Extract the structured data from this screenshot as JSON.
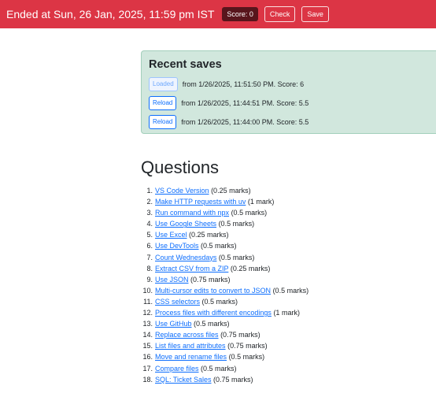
{
  "topbar": {
    "title": "Ended at Sun, 26 Jan, 2025, 11:59 pm IST",
    "score_label": "Score: 0",
    "check_label": "Check",
    "save_label": "Save"
  },
  "recent_saves": {
    "title": "Recent saves",
    "items": [
      {
        "button": "Loaded",
        "text": "from 1/26/2025, 11:51:50 PM. Score: 6"
      },
      {
        "button": "Reload",
        "text": "from 1/26/2025, 11:44:51 PM. Score: 5.5"
      },
      {
        "button": "Reload",
        "text": "from 1/26/2025, 11:44:00 PM. Score: 5.5"
      }
    ]
  },
  "questions": {
    "title": "Questions",
    "items": [
      {
        "label": "VS Code Version",
        "marks": "(0.25 marks)"
      },
      {
        "label": "Make HTTP requests with uv",
        "marks": "(1 mark)"
      },
      {
        "label": "Run command with npx",
        "marks": "(0.5 marks)"
      },
      {
        "label": "Use Google Sheets",
        "marks": "(0.5 marks)"
      },
      {
        "label": "Use Excel",
        "marks": "(0.25 marks)"
      },
      {
        "label": "Use DevTools",
        "marks": "(0.5 marks)"
      },
      {
        "label": "Count Wednesdays",
        "marks": "(0.5 marks)"
      },
      {
        "label": "Extract CSV from a ZIP",
        "marks": "(0.25 marks)"
      },
      {
        "label": "Use JSON",
        "marks": "(0.75 marks)"
      },
      {
        "label": "Multi-cursor edits to convert to JSON",
        "marks": "(0.5 marks)"
      },
      {
        "label": "CSS selectors",
        "marks": "(0.5 marks)"
      },
      {
        "label": "Process files with different encodings",
        "marks": "(1 mark)"
      },
      {
        "label": "Use GitHub",
        "marks": "(0.5 marks)"
      },
      {
        "label": "Replace across files",
        "marks": "(0.75 marks)"
      },
      {
        "label": "List files and attributes",
        "marks": "(0.75 marks)"
      },
      {
        "label": "Move and rename files",
        "marks": "(0.5 marks)"
      },
      {
        "label": "Compare files",
        "marks": "(0.5 marks)"
      },
      {
        "label": "SQL: Ticket Sales",
        "marks": "(0.75 marks)"
      }
    ]
  },
  "colors": {
    "topbar_bg": "#dc3545",
    "panel_bg": "#d1e7dd",
    "link": "#0d6efd"
  }
}
